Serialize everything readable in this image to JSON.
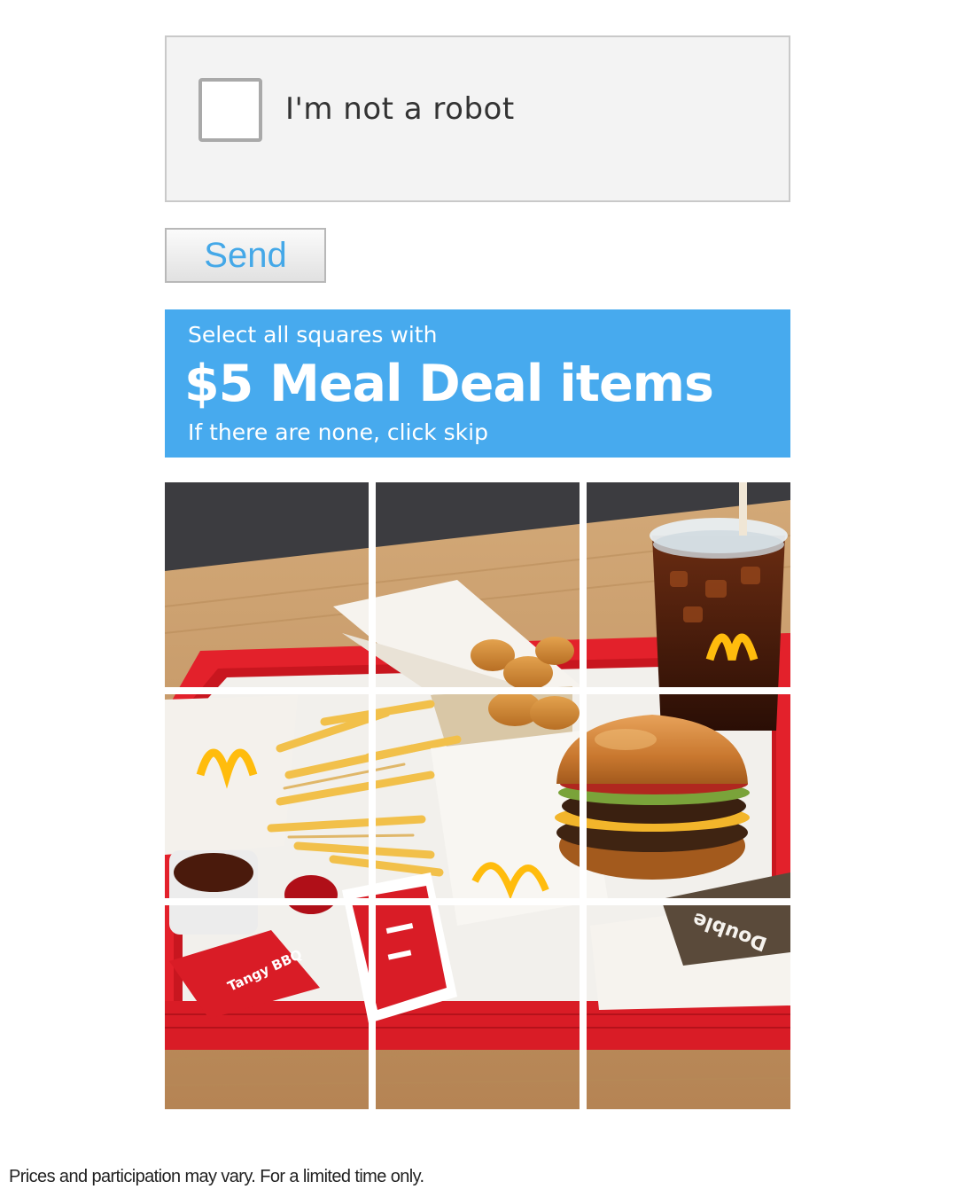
{
  "captcha": {
    "checkbox_label": "I'm not a robot",
    "checked": false
  },
  "send_button": {
    "label": "Send",
    "color": "#44a8e8"
  },
  "challenge": {
    "line1": "Select all squares with",
    "target": "$5 Meal Deal items",
    "line3": "If there are none, click skip",
    "background_color": "#47aaee"
  },
  "grid": {
    "rows": 3,
    "cols": 3,
    "tiles": [
      {
        "row": 1,
        "col": 1,
        "content": "tray corner, table edge"
      },
      {
        "row": 1,
        "col": 2,
        "content": "open nugget box"
      },
      {
        "row": 1,
        "col": 3,
        "content": "soda cup with lid and straw"
      },
      {
        "row": 2,
        "col": 1,
        "content": "fries bag"
      },
      {
        "row": 2,
        "col": 2,
        "content": "fries and nuggets"
      },
      {
        "row": 2,
        "col": 3,
        "content": "double cheeseburger"
      },
      {
        "row": 3,
        "col": 1,
        "content": "tangy bbq sauce dip"
      },
      {
        "row": 3,
        "col": 2,
        "content": "ketchup packets"
      },
      {
        "row": 3,
        "col": 3,
        "content": "burger wrapper"
      }
    ],
    "printed_text": {
      "sauce_label": "Tangy BBQ",
      "wrapper_label": "Double"
    },
    "colors": {
      "tray": "#e3212b",
      "table": "#c99a66",
      "brand_yellow": "#ffbc0d"
    }
  },
  "disclaimer": "Prices and participation may vary. For a limited time only."
}
